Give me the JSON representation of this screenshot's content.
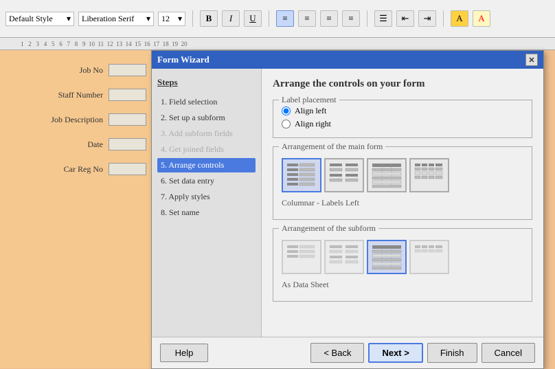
{
  "toolbar": {
    "style_value": "Default Style",
    "font_value": "Liberation Serif",
    "size_value": "12",
    "buttons": [
      "B",
      "I",
      "U"
    ]
  },
  "form": {
    "fields": [
      {
        "label": "Job No",
        "id": "job-no"
      },
      {
        "label": "Staff Number",
        "id": "staff-number"
      },
      {
        "label": "Job Description",
        "id": "job-desc"
      },
      {
        "label": "Date",
        "id": "date"
      },
      {
        "label": "Car Reg No",
        "id": "car-reg"
      }
    ]
  },
  "dialog": {
    "title": "Form Wizard",
    "close_label": "✕",
    "steps_heading": "Steps",
    "steps": [
      {
        "label": "1. Field selection",
        "state": "normal"
      },
      {
        "label": "2. Set up a subform",
        "state": "normal"
      },
      {
        "label": "3. Add subform fields",
        "state": "disabled"
      },
      {
        "label": "4. Get joined fields",
        "state": "disabled"
      },
      {
        "label": "5. Arrange controls",
        "state": "active"
      },
      {
        "label": "6. Set data entry",
        "state": "normal"
      },
      {
        "label": "7. Apply styles",
        "state": "normal"
      },
      {
        "label": "8. Set name",
        "state": "normal"
      }
    ],
    "panel_title": "Arrange the controls on your form",
    "label_placement_legend": "Label placement",
    "radio_options": [
      {
        "label": "Align left",
        "checked": true
      },
      {
        "label": "Align right",
        "checked": false
      }
    ],
    "arrangement_main_legend": "Arrangement of the main form",
    "arrangement_options": [
      {
        "id": "columnar-labels-left",
        "selected": true
      },
      {
        "id": "columnar-labels-top",
        "selected": false
      },
      {
        "id": "tabular",
        "selected": false
      },
      {
        "id": "data-sheet-main",
        "selected": false
      }
    ],
    "arrangement_main_label": "Columnar - Labels Left",
    "arrangement_sub_legend": "Arrangement of the subform",
    "arrangement_sub_options": [
      {
        "id": "sub-columnar-left",
        "selected": false
      },
      {
        "id": "sub-columnar-top",
        "selected": false
      },
      {
        "id": "sub-tabular",
        "selected": true
      },
      {
        "id": "sub-data-sheet",
        "selected": false
      }
    ],
    "arrangement_sub_label": "As Data Sheet",
    "buttons": {
      "help": "Help",
      "back": "< Back",
      "next": "Next >",
      "finish": "Finish",
      "cancel": "Cancel"
    }
  }
}
